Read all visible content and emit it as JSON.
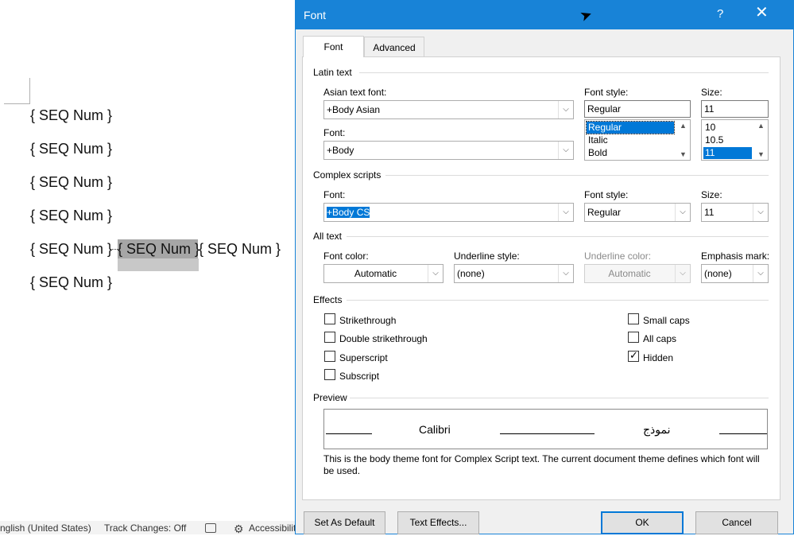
{
  "document": {
    "fields": [
      "{ SEQ Num }",
      "{ SEQ Num }",
      "{ SEQ Num }",
      "{ SEQ Num }",
      "{ SEQ Num }",
      "{ SEQ Num }",
      "{ SEQ Num }",
      "{ SEQ Num }"
    ]
  },
  "statusbar": {
    "language": "nglish (United States)",
    "track_changes": "Track Changes: Off",
    "accessibility": "Accessibilit"
  },
  "dialog": {
    "title": "Font",
    "help": "?",
    "close": "✕",
    "tabs": [
      "Font",
      "Advanced"
    ],
    "latin_text": {
      "group": "Latin text",
      "asian_font_label": "Asian text font:",
      "asian_font_value": "+Body Asian",
      "font_label": "Font:",
      "font_value": "+Body",
      "style_label": "Font style:",
      "style_value": "Regular",
      "style_options": [
        "Regular",
        "Italic",
        "Bold"
      ],
      "size_label": "Size:",
      "size_value": "11",
      "size_options": [
        "10",
        "10.5",
        "11"
      ]
    },
    "complex_scripts": {
      "group": "Complex scripts",
      "font_label": "Font:",
      "font_value": "+Body CS",
      "style_label": "Font style:",
      "style_value": "Regular",
      "size_label": "Size:",
      "size_value": "11"
    },
    "all_text": {
      "group": "All text",
      "font_color_label": "Font color:",
      "font_color_value": "Automatic",
      "underline_style_label": "Underline style:",
      "underline_style_value": "(none)",
      "underline_color_label": "Underline color:",
      "underline_color_value": "Automatic",
      "emphasis_label": "Emphasis mark:",
      "emphasis_value": "(none)"
    },
    "effects": {
      "group": "Effects",
      "strikethrough": "Strikethrough",
      "double_strikethrough": "Double strikethrough",
      "superscript": "Superscript",
      "subscript": "Subscript",
      "small_caps": "Small caps",
      "all_caps": "All caps",
      "hidden": "Hidden",
      "hidden_checked": true
    },
    "preview": {
      "group": "Preview",
      "latin_sample": "Calibri",
      "arabic_sample": "نموذج",
      "description": "This is the body theme font for Complex Script text. The current document theme defines which font will be used."
    },
    "buttons": {
      "set_default": "Set As Default",
      "text_effects": "Text Effects...",
      "ok": "OK",
      "cancel": "Cancel"
    }
  }
}
